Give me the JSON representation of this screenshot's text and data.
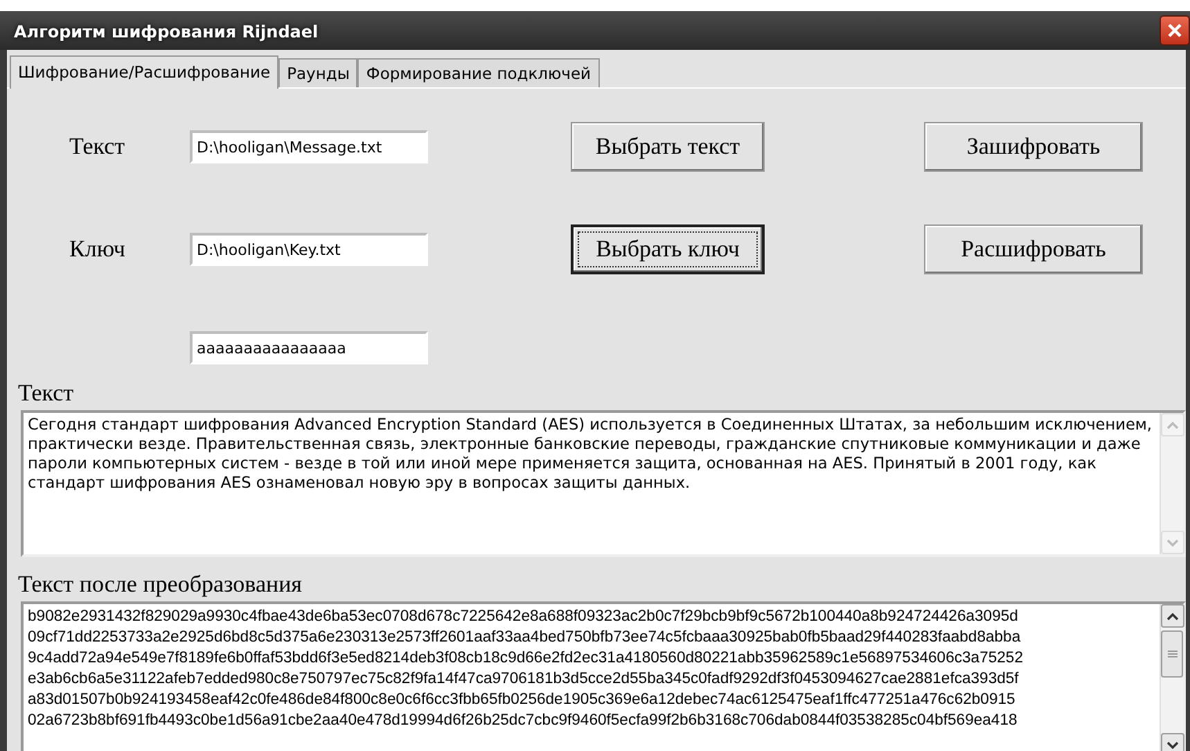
{
  "window": {
    "title": "Алгоритм шифрования Rijndael"
  },
  "tabs": [
    {
      "label": "Шифрование/Расшифрование",
      "selected": true
    },
    {
      "label": "Раунды",
      "selected": false
    },
    {
      "label": "Формирование подключей",
      "selected": false
    }
  ],
  "form": [
    {
      "label": "Текст",
      "value": "D:\\hooligan\\Message.txt",
      "button": {
        "label": "Выбрать текст",
        "focused": false
      },
      "action": {
        "label": "Зашифровать",
        "focused": false
      }
    },
    {
      "label": "Ключ",
      "value": "D:\\hooligan\\Key.txt",
      "button": {
        "label": "Выбрать ключ",
        "focused": true
      },
      "action": {
        "label": "Расшифровать",
        "focused": false
      }
    },
    {
      "value": "aaaaaaaaaaaaaaaa"
    }
  ],
  "source": {
    "heading": "Текст",
    "text": "Сегодня стандарт шифрования Advanced Encryption Standard (AES) используется в Соединенных Штатах, за небольшим исключением, практически везде. Правительственная связь, электронные банковские переводы, гражданские спутниковые коммуникации и даже пароли компьютерных систем - везде в той или иной мере применяется защита, основанная на AES. Принятый в 2001 году, как стандарт шифрования AES ознаменовал новую эру в вопросах защиты данных."
  },
  "result": {
    "heading": "Текст после преобразования",
    "lines": [
      "b9082e2931432f829029a9930c4fbae43de6ba53ec0708d678c7225642e8a688f09323ac2b0c7f29bcb9bf9c5672b100440a8b924724426a3095d",
      "09cf71dd2253733a2e2925d6bd8c5d375a6e230313e2573ff2601aaf33aa4bed750bfb73ee74c5fcbaaa30925bab0fb5baad29f440283faabd8abba",
      "9c4add72a94e549e7f8189fe6b0ffaf53bdd6f3e5ed8214deb3f08cb18c9d66e2fd2ec31a4180560d80221abb35962589c1e56897534606c3a75252",
      "e3ab6cb6a5e31122afeb7edded980c8e750797ec75c82f9fa14f47ca9706181b3d5cce2d55ba345c0fadf9292df3f0453094627cae2881efca393d5f",
      "a83d01507b0b924193458eaf42c0fe486de84f800c8e0c6f6cc3fbb65fb0256de1905c369e6a12debec74ac6125475eaf1ffc477251a476c62b0915",
      "02a6723b8bf691fb4493c0be1d56a91cbe2aa40e478d19994d6f26b25dc7cbc9f9460f5ecfa99f2b6b3168c706dab0844f03538285c04bf569ea418"
    ]
  }
}
